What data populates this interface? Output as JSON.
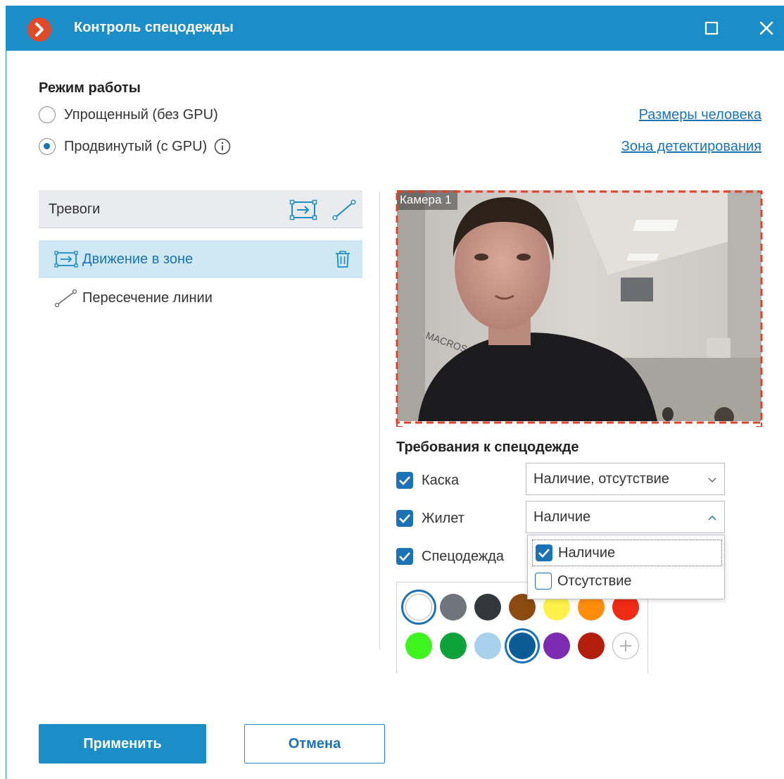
{
  "window": {
    "title": "Контроль спецодежды"
  },
  "mode": {
    "title": "Режим работы",
    "options": [
      {
        "label": "Упрощенный (без GPU)",
        "selected": false
      },
      {
        "label": "Продвинутый (с GPU)",
        "selected": true
      }
    ]
  },
  "links": {
    "person_size": "Размеры человека",
    "detection_zone": "Зона детектирования"
  },
  "alarms": {
    "header": "Тревоги",
    "items": [
      {
        "label": "Движение в зоне",
        "selected": true
      },
      {
        "label": "Пересечение линии",
        "selected": false
      }
    ]
  },
  "camera": {
    "label": "Камера 1"
  },
  "requirements": {
    "title": "Требования к спецодежде",
    "items": [
      {
        "label": "Каска",
        "checked": true,
        "value": "Наличие, отсутствие"
      },
      {
        "label": "Жилет",
        "checked": true,
        "value": "Наличие"
      },
      {
        "label": "Спецодежда",
        "checked": true
      }
    ],
    "dropdown_options": [
      {
        "label": "Наличие",
        "checked": true
      },
      {
        "label": "Отсутствие",
        "checked": false
      }
    ]
  },
  "palette": {
    "colors": [
      "#ffffff",
      "#6f757c",
      "#33363b",
      "#8a4a10",
      "#fff04a",
      "#ff8c0a",
      "#ee2b14",
      "#3df51c",
      "#0da33a",
      "#a9d0ec",
      "#0a5c96",
      "#7d2bb0",
      "#b31d0c"
    ],
    "selected": [
      "#ffffff",
      "#0a5c96"
    ]
  },
  "buttons": {
    "apply": "Применить",
    "cancel": "Отмена"
  },
  "colors": {
    "accent": "#1b8dc7",
    "link": "#1b73b5",
    "logo": "#e14a28",
    "zone_border": "#e0432a"
  }
}
